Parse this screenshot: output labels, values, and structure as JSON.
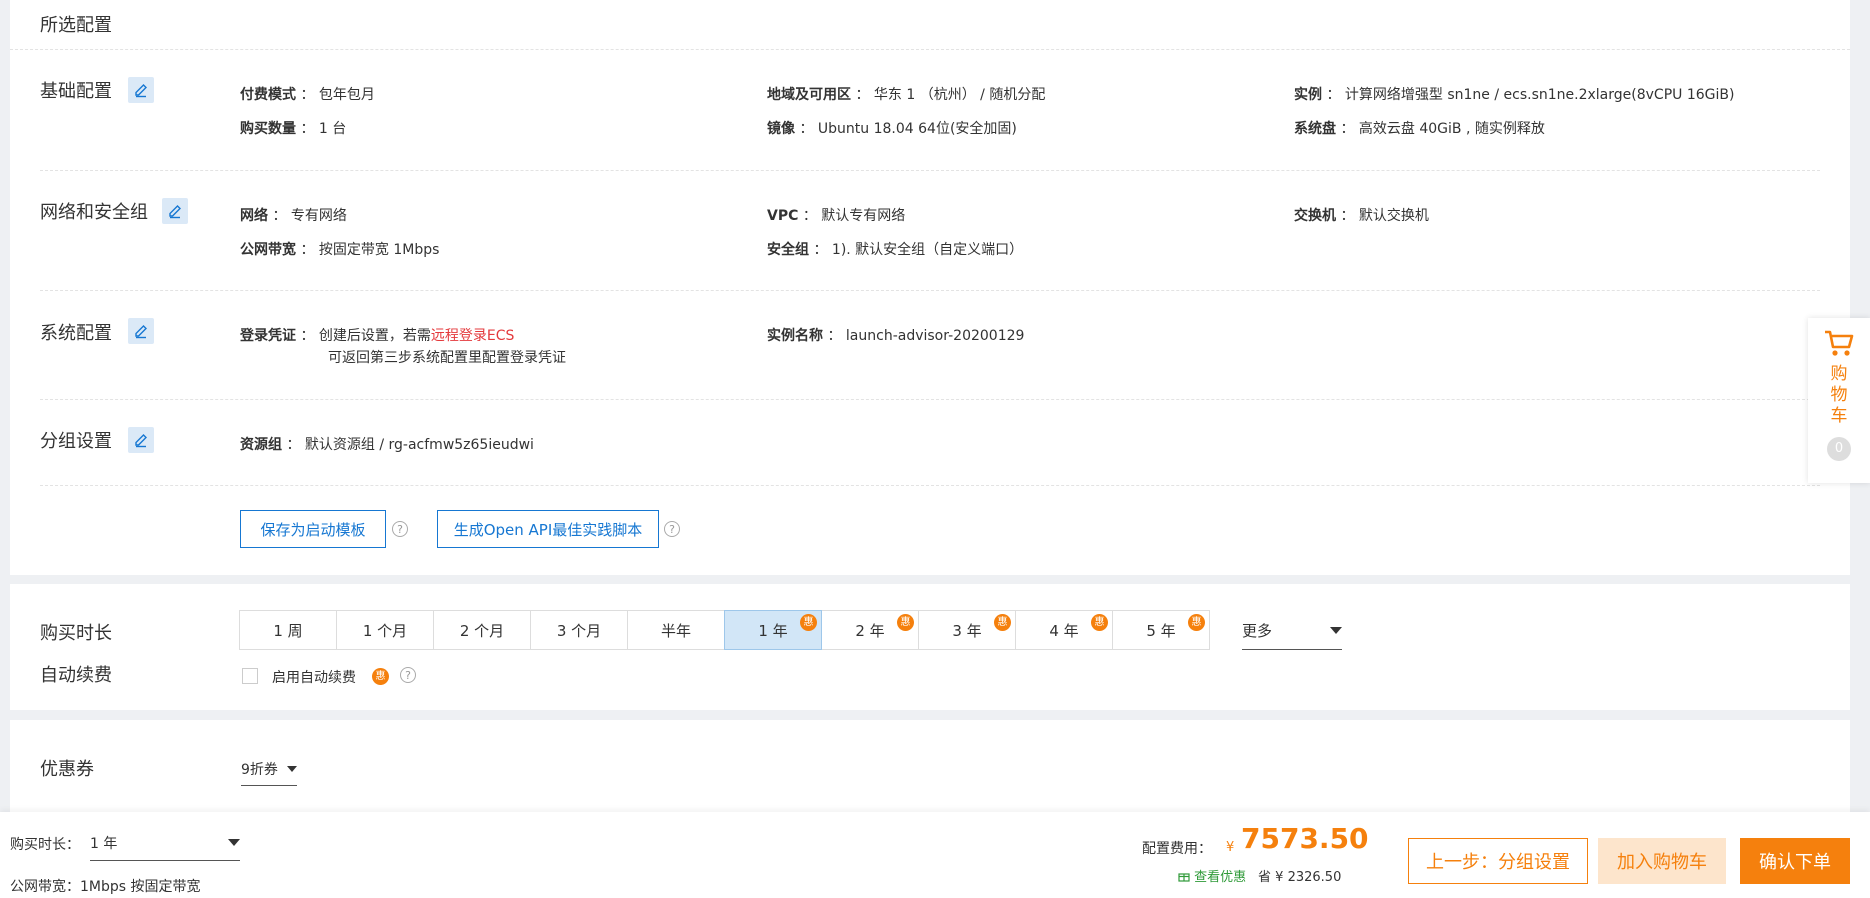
{
  "selected_config": {
    "title": "所选配置",
    "sections": [
      {
        "title": "基础配置",
        "fields": [
          {
            "label": "付费模式",
            "value": "包年包月"
          },
          {
            "label": "地域及可用区",
            "value": "华东 1 （杭州） / 随机分配"
          },
          {
            "label": "实例",
            "value": "计算网络增强型 sn1ne / ecs.sn1ne.2xlarge(8vCPU 16GiB)"
          },
          {
            "label": "购买数量",
            "value": "1 台"
          },
          {
            "label": "镜像",
            "value": "Ubuntu 18.04 64位(安全加固)"
          },
          {
            "label": "系统盘",
            "value": "高效云盘 40GiB , 随实例释放"
          }
        ]
      },
      {
        "title": "网络和安全组",
        "fields": [
          {
            "label": "网络",
            "value": "专有网络"
          },
          {
            "label": "VPC",
            "value": "默认专有网络"
          },
          {
            "label": "交换机",
            "value": "默认交换机"
          },
          {
            "label": "公网带宽",
            "value": "按固定带宽 1Mbps"
          },
          {
            "label": "安全组",
            "value": "1). 默认安全组（自定义端口）"
          }
        ]
      },
      {
        "title": "系统配置",
        "fields": [
          {
            "label": "登录凭证",
            "value_prefix": "创建后设置，若需",
            "value_link": "远程登录ECS",
            "value_line2": "可返回第三步系统配置里配置登录凭证"
          },
          {
            "label": "实例名称",
            "value": "launch-advisor-20200129"
          }
        ]
      },
      {
        "title": "分组设置",
        "fields": [
          {
            "label": "资源组",
            "value": "默认资源组 / rg-acfmw5z65ieudwi"
          }
        ]
      }
    ],
    "separator": "：",
    "buttons": {
      "save_template": "保存为启动模板",
      "gen_api": "生成Open API最佳实践脚本"
    },
    "help": "?"
  },
  "purchase": {
    "duration_label": "购买时长",
    "auto_renew_label": "自动续费",
    "durations": [
      {
        "label": "1 周",
        "badge": ""
      },
      {
        "label": "1 个月",
        "badge": ""
      },
      {
        "label": "2 个月",
        "badge": ""
      },
      {
        "label": "3 个月",
        "badge": ""
      },
      {
        "label": "半年",
        "badge": ""
      },
      {
        "label": "1 年",
        "badge": "惠"
      },
      {
        "label": "2 年",
        "badge": "惠"
      },
      {
        "label": "3 年",
        "badge": "惠"
      },
      {
        "label": "4 年",
        "badge": "惠"
      },
      {
        "label": "5 年",
        "badge": "惠"
      }
    ],
    "selected_duration": "1 年",
    "more": "更多",
    "auto_renew_text": "启用自动续费",
    "auto_renew_badge": "惠",
    "auto_renew_checked": false
  },
  "coupon": {
    "label": "优惠券",
    "value": "9折券"
  },
  "cart": {
    "chars": [
      "购",
      "物",
      "车"
    ],
    "count": "0"
  },
  "footer": {
    "duration_label": "购买时长：",
    "duration_value": "1 年",
    "bandwidth": "公网带宽：1Mbps 按固定带宽",
    "cost_label": "配置费用：",
    "currency": "¥",
    "cost": "7573.50",
    "discount_link": "查看优惠",
    "save_label": "省",
    "save_amount": "2326.50",
    "prev_button": "上一步：分组设置",
    "add_cart_button": "加入购物车",
    "confirm_button": "确认下单"
  },
  "colors": {
    "primary": "#1677d2",
    "orange": "#f5800d",
    "price": "#f5800d",
    "red": "#e4393c",
    "green": "#2f9a38",
    "selected_bg": "#d2e6f7"
  }
}
